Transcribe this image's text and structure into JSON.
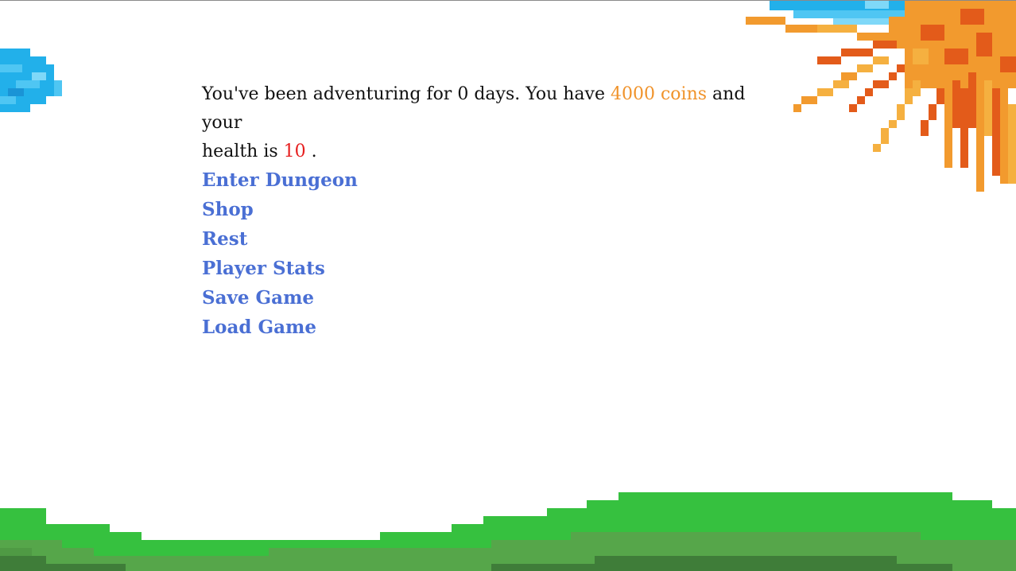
{
  "status": {
    "prefix": "You've been adventuring for",
    "days": "0",
    "middle": "days. You have",
    "coins": "4000 coins",
    "and_your": "and your",
    "health_is": "health is",
    "health": "10",
    "suffix": "."
  },
  "menu": {
    "items": [
      {
        "label": "Enter Dungeon"
      },
      {
        "label": "Shop"
      },
      {
        "label": "Rest"
      },
      {
        "label": "Player Stats"
      },
      {
        "label": "Save Game"
      },
      {
        "label": "Load Game"
      }
    ]
  },
  "colors": {
    "link": "#4a6fd4",
    "coins": "#f0932b",
    "health": "#e61e1e",
    "grass_light": "#36c13f",
    "grass_mid": "#56a64a",
    "grass_dark": "#3f7d39",
    "sky_blue": "#29b6ec",
    "sun_orange": "#f29a2e",
    "sun_red": "#e35b1a"
  },
  "scenery": {
    "icons": [
      "pixel-sun-icon",
      "pixel-cloud-icon",
      "pixel-hills-icon"
    ]
  }
}
